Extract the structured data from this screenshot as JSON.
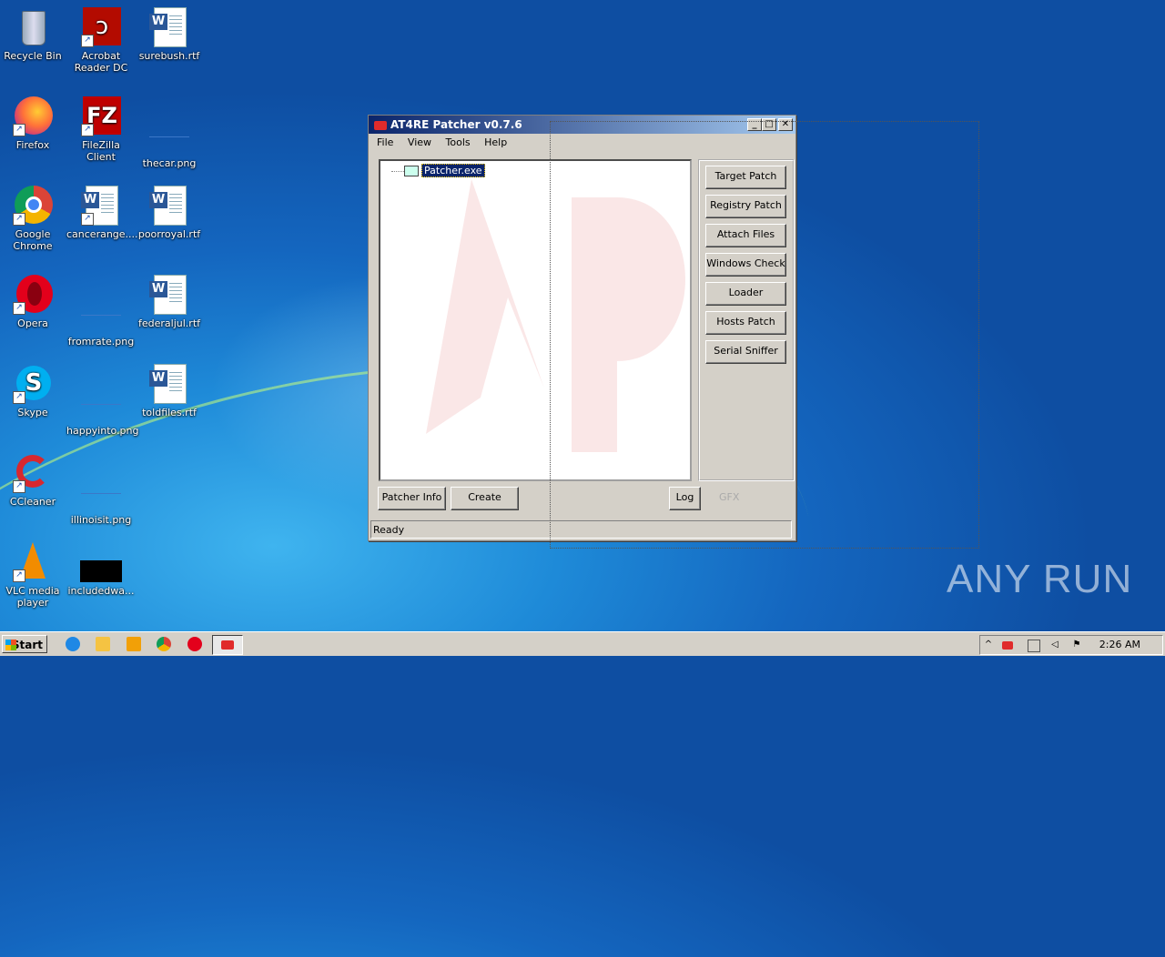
{
  "desktop": {
    "icons": [
      {
        "label": "Recycle Bin"
      },
      {
        "label": "Acrobat Reader DC"
      },
      {
        "label": "surebush.rtf"
      },
      {
        "label": "Firefox"
      },
      {
        "label": "FileZilla Client"
      },
      {
        "label": "thecar.png"
      },
      {
        "label": "Google Chrome"
      },
      {
        "label": "cancerange...."
      },
      {
        "label": "poorroyal.rtf"
      },
      {
        "label": "Opera"
      },
      {
        "label": "fromrate.png"
      },
      {
        "label": "federaljul.rtf"
      },
      {
        "label": "Skype"
      },
      {
        "label": "happyinto.png"
      },
      {
        "label": "toldfiles.rtf"
      },
      {
        "label": "CCleaner"
      },
      {
        "label": "illinoisit.png"
      },
      {
        "label": "VLC media player"
      },
      {
        "label": "includedwa..."
      }
    ]
  },
  "window": {
    "title": "AT4RE Patcher v0.7.6",
    "menu": [
      "File",
      "View",
      "Tools",
      "Help"
    ],
    "tree_item": "Patcher.exe",
    "side_buttons": [
      "Target Patch",
      "Registry Patch",
      "Attach Files",
      "Windows Check",
      "Loader",
      "Hosts Patch",
      "Serial Sniffer"
    ],
    "bottom_buttons": {
      "patcher_info": "Patcher Info",
      "create": "Create",
      "log": "Log"
    },
    "gfx_label": "GFX",
    "status": "Ready"
  },
  "taskbar": {
    "start_label": "Start",
    "clock": "2:26 AM"
  },
  "watermark": "ANY RUN",
  "colors": {
    "title_start": "#0a246a",
    "title_end": "#a6caf0",
    "selection": "#0a246a",
    "brand_red": "#e02b2b"
  }
}
